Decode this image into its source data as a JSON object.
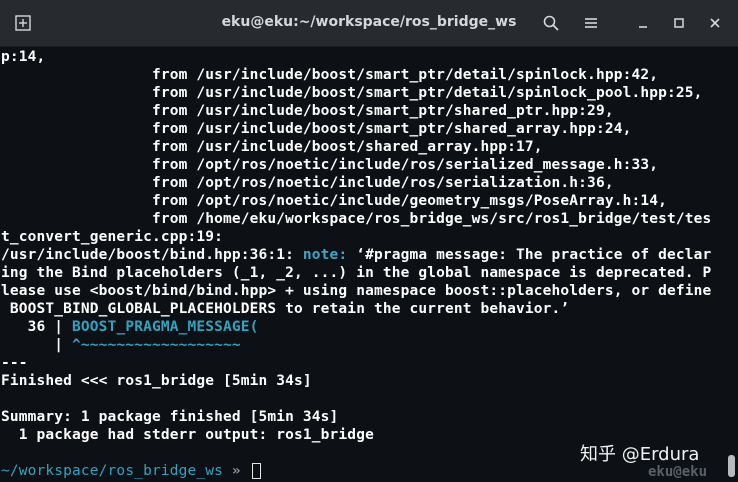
{
  "window": {
    "title": "eku@eku:~/workspace/ros_bridge_ws",
    "new_tab_icon": "new-tab-icon",
    "search_icon": "search-icon",
    "menu_icon": "hamburger-menu-icon",
    "minimize_icon": "minimize-icon",
    "maximize_icon": "maximize-icon",
    "close_icon": "close-icon"
  },
  "terminal": {
    "lines": [
      "p:14,",
      "                 from /usr/include/boost/smart_ptr/detail/spinlock.hpp:42,",
      "                 from /usr/include/boost/smart_ptr/detail/spinlock_pool.hpp:25,",
      "                 from /usr/include/boost/smart_ptr/shared_ptr.hpp:29,",
      "                 from /usr/include/boost/smart_ptr/shared_array.hpp:24,",
      "                 from /usr/include/boost/shared_array.hpp:17,",
      "                 from /opt/ros/noetic/include/ros/serialized_message.h:33,",
      "                 from /opt/ros/noetic/include/ros/serialization.h:36,",
      "                 from /opt/ros/noetic/include/geometry_msgs/PoseArray.h:14,",
      "                 from /home/eku/workspace/ros_bridge_ws/src/ros1_bridge/test/tes",
      "t_convert_generic.cpp:19:"
    ],
    "note_prefix": "/usr/include/boost/bind.hpp:36:1: ",
    "note_label": "note:",
    "note_rest": " ‘#pragma message: The practice of declar",
    "note_cont": [
      "ing the Bind placeholders (_1, _2, ...) in the global namespace is deprecated. P",
      "lease use <boost/bind/bind.hpp> + using namespace boost::placeholders, or define",
      " BOOST_BIND_GLOBAL_PLACEHOLDERS to retain the current behavior.’"
    ],
    "code_line_no": "   36 | ",
    "code_text": "BOOST_PRAGMA_MESSAGE(",
    "caret_gutter": "      | ",
    "caret_text": "^~~~~~~~~~~~~~~~~~~",
    "separator": "---",
    "finished": "Finished <<< ros1_bridge [5min 34s]",
    "blank": "",
    "summary": "Summary: 1 package finished [5min 34s]",
    "stderr_note": "  1 package had stderr output: ros1_bridge",
    "prompt_path": "~/workspace/ros_bridge_ws",
    "prompt_arrow": " » ",
    "prompt_host": "eku@eku"
  },
  "watermark": "知乎 @Erdura",
  "colors": {
    "background": "#0d1014",
    "titlebar": "#272a2e",
    "note": "#3ea7c9",
    "code": "#2fa3c2"
  }
}
